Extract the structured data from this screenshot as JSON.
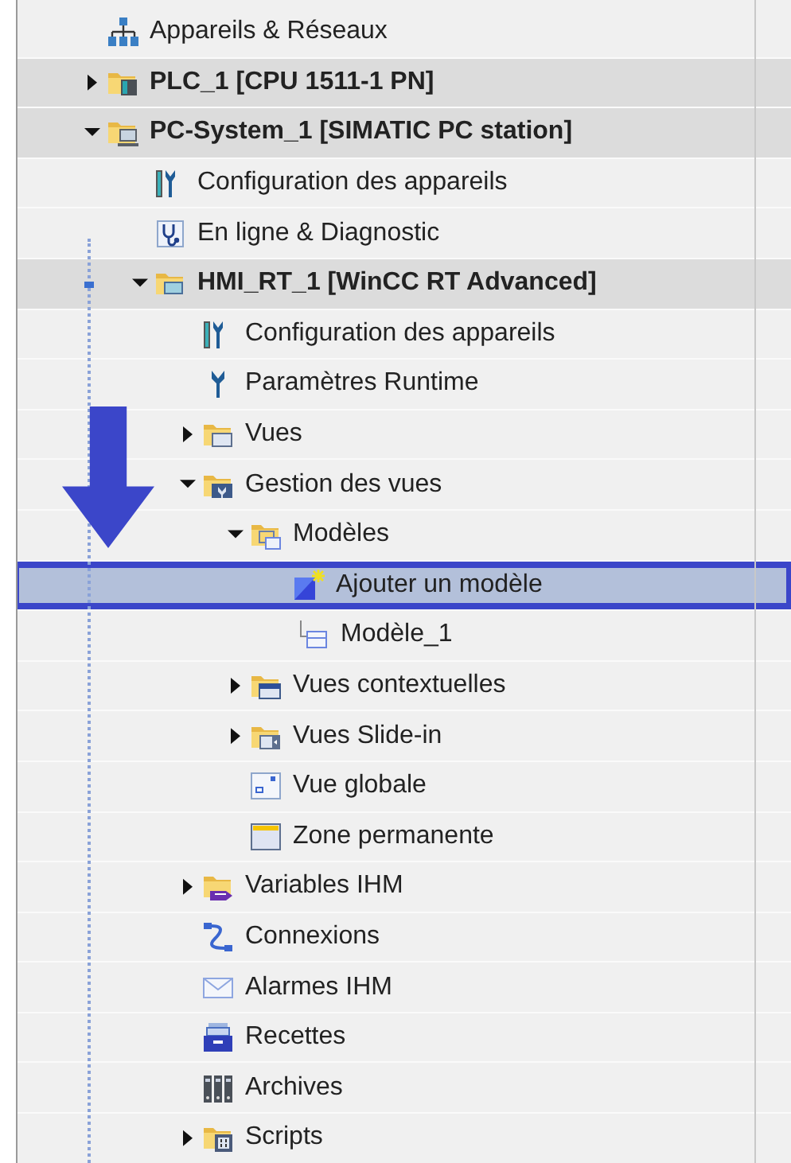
{
  "tree": [
    {
      "label": "Appareils & Réseaux",
      "kind": "network",
      "selected": false
    },
    {
      "label": "PLC_1 [CPU 1511-1 PN]",
      "kind": "plc",
      "expanded": false,
      "selected": false
    },
    {
      "label": "PC-System_1 [SIMATIC PC station]",
      "kind": "pc",
      "expanded": true,
      "selected": false,
      "children": [
        {
          "label": "Configuration des appareils",
          "kind": "config",
          "selected": false
        },
        {
          "label": "En ligne & Diagnostic",
          "kind": "diagnostic",
          "selected": false
        },
        {
          "label": "HMI_RT_1 [WinCC RT Advanced]",
          "kind": "hmi",
          "expanded": true,
          "selected": false,
          "children": [
            {
              "label": "Configuration des appareils",
              "kind": "config",
              "selected": false
            },
            {
              "label": "Paramètres Runtime",
              "kind": "runtime",
              "selected": false
            },
            {
              "label": "Vues",
              "kind": "folder-screens",
              "expanded": false,
              "selected": false
            },
            {
              "label": "Gestion des vues",
              "kind": "folder-manage",
              "expanded": true,
              "selected": false,
              "children": [
                {
                  "label": "Modèles",
                  "kind": "folder-templates",
                  "expanded": true,
                  "selected": false,
                  "children": [
                    {
                      "label": "Ajouter un modèle",
                      "kind": "add-template",
                      "selected": true
                    },
                    {
                      "label": "Modèle_1",
                      "kind": "template",
                      "selected": false
                    }
                  ]
                },
                {
                  "label": "Vues contextuelles",
                  "kind": "folder-popup",
                  "expanded": false,
                  "selected": false
                },
                {
                  "label": "Vues Slide-in",
                  "kind": "folder-slidein",
                  "expanded": false,
                  "selected": false
                },
                {
                  "label": "Vue globale",
                  "kind": "global-view",
                  "selected": false
                },
                {
                  "label": "Zone permanente",
                  "kind": "permanent-area",
                  "selected": false
                }
              ]
            },
            {
              "label": "Variables IHM",
              "kind": "folder-tags",
              "expanded": false,
              "selected": false
            },
            {
              "label": "Connexions",
              "kind": "connections",
              "selected": false
            },
            {
              "label": "Alarmes IHM",
              "kind": "alarms",
              "selected": false
            },
            {
              "label": "Recettes",
              "kind": "recipes",
              "selected": false
            },
            {
              "label": "Archives",
              "kind": "archives",
              "selected": false
            },
            {
              "label": "Scripts",
              "kind": "folder-scripts",
              "expanded": false,
              "selected": false
            }
          ]
        }
      ]
    }
  ]
}
